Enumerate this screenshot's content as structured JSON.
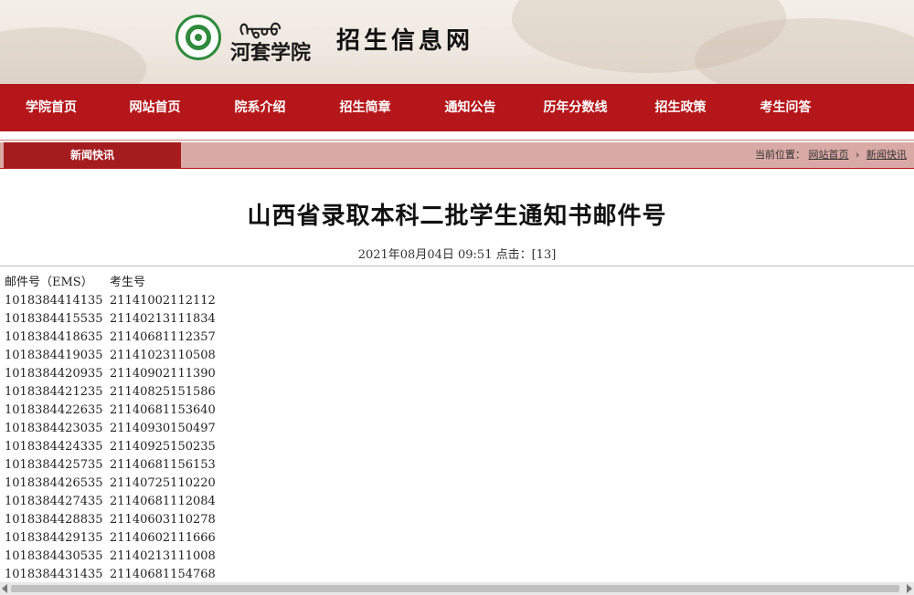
{
  "header": {
    "mongolian_text": "ᠬᠡᠲᠤᠣ",
    "school_name": "河套学院",
    "site_name": "招生信息网"
  },
  "nav": {
    "items": [
      "学院首页",
      "网站首页",
      "院系介绍",
      "招生简章",
      "通知公告",
      "历年分数线",
      "招生政策",
      "考生问答"
    ]
  },
  "subbar": {
    "section": "新闻快讯",
    "breadcrumb_prefix": "当前位置：",
    "crumb1": "网站首页",
    "crumb2": "新闻快讯"
  },
  "article": {
    "title": "山西省录取本科二批学生通知书邮件号",
    "meta": "2021年08月04日 09:51  点击：[13]",
    "header_col1": "邮件号（EMS）",
    "header_col2": "考生号",
    "rows": [
      [
        "1018384414135",
        "21141002112112"
      ],
      [
        "1018384415535",
        "21140213111834"
      ],
      [
        "1018384418635",
        "21140681112357"
      ],
      [
        "1018384419035",
        "21141023110508"
      ],
      [
        "1018384420935",
        "21140902111390"
      ],
      [
        "1018384421235",
        "21140825151586"
      ],
      [
        "1018384422635",
        "21140681153640"
      ],
      [
        "1018384423035",
        "21140930150497"
      ],
      [
        "1018384424335",
        "21140925150235"
      ],
      [
        "1018384425735",
        "21140681156153"
      ],
      [
        "1018384426535",
        "21140725110220"
      ],
      [
        "1018384427435",
        "21140681112084"
      ],
      [
        "1018384428835",
        "21140603110278"
      ],
      [
        "1018384429135",
        "21140602111666"
      ],
      [
        "1018384430535",
        "21140213111008"
      ],
      [
        "1018384431435",
        "21140681154768"
      ]
    ]
  },
  "colors": {
    "nav_bg": "#b5161a",
    "subbar_bg": "#d9a9a5",
    "section_tab_bg": "#a51c1f",
    "logo_green": "#2f8a3c"
  }
}
